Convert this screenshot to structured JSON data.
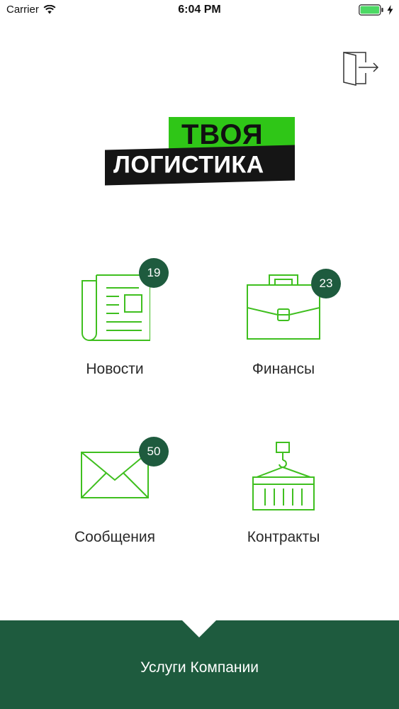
{
  "status_bar": {
    "carrier": "Carrier",
    "time": "6:04 PM"
  },
  "logo": {
    "line1": "ТВОЯ",
    "line2": "ЛОГИСТИКА"
  },
  "tiles": [
    {
      "label": "Новости",
      "badge": "19",
      "icon": "newspaper-icon"
    },
    {
      "label": "Финансы",
      "badge": "23",
      "icon": "briefcase-icon"
    },
    {
      "label": "Сообщения",
      "badge": "50",
      "icon": "envelope-icon"
    },
    {
      "label": "Контракты",
      "badge": null,
      "icon": "container-crane-icon"
    }
  ],
  "bottom_bar": {
    "label": "Услуги Компании"
  },
  "colors": {
    "accent_green": "#2fc617",
    "dark_green": "#1e5b3e",
    "icon_green": "#3fbf1f"
  }
}
